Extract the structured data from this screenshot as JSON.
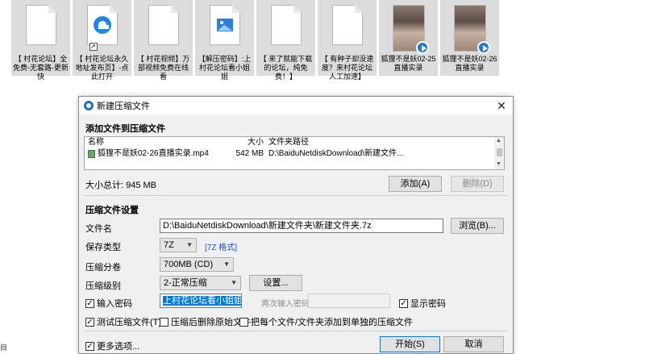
{
  "desktop": {
    "files": [
      {
        "label": "【 村花论坛】全免费-无套路-更新快",
        "kind": "doc"
      },
      {
        "label": "【 村花论坛永久地址发布页】-点此打开",
        "kind": "edge-shortcut"
      },
      {
        "label": "【 村花视频】万部视频免费在线看",
        "kind": "doc"
      },
      {
        "label": "【解压密码】:上村花论坛看小姐姐",
        "kind": "image"
      },
      {
        "label": "【 来了就能下载的论坛，纯免费！】",
        "kind": "doc"
      },
      {
        "label": "【 有种子却没速度？来村花论坛人工加速】",
        "kind": "doc"
      },
      {
        "label": "狐狸不是妖02-25直播实录",
        "kind": "video"
      },
      {
        "label": "狐狸不是妖02-26直播实录",
        "kind": "video"
      }
    ],
    "left_edge_char": "目"
  },
  "dialog": {
    "title": "新建压缩文件",
    "close": "✕",
    "add_section_title": "添加文件到压缩文件",
    "list": {
      "headers": {
        "name": "名称",
        "size": "大小",
        "path": "文件夹路径"
      },
      "rows": [
        {
          "name": "狐狸不是妖02-26直播实录.mp4",
          "size": "542 MB",
          "path": "D:\\BaiduNetdiskDownload\\新建文件..."
        }
      ]
    },
    "total_size": "大小总计: 945 MB",
    "add_button": "添加(A)",
    "delete_button": "删除(D)",
    "settings_title": "压缩文件设置",
    "filename_label": "文件名",
    "filename_value": "D:\\BaiduNetdiskDownload\\新建文件夹\\新建文件夹.7z",
    "browse_button": "浏览(B)...",
    "type_label": "保存类型",
    "type_value": "7Z",
    "type_link": "[7Z 格式]",
    "split_label": "压缩分卷",
    "split_value": "700MB (CD)",
    "level_label": "压缩级别",
    "level_value": "2-正常压缩",
    "settings_button": "设置...",
    "password_label": "输入密码",
    "password_value": "上村花论坛看小姐姐",
    "reenter_label": "再次输入密码",
    "show_password_label": "显示密码",
    "test_label": "测试压缩文件(T)",
    "delete_after_label": "压缩后删除原始文件",
    "separate_label": "把每个文件/文件夹添加到单独的压缩文件",
    "more_options_label": "更多选项...",
    "start_button": "开始(S)",
    "cancel_button": "取消"
  }
}
